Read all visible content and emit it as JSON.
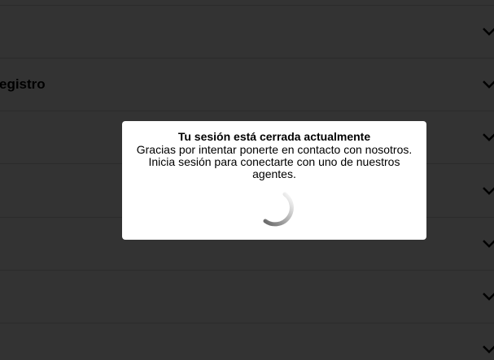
{
  "accordion": {
    "items": [
      {
        "label": ""
      },
      {
        "label": "egistro"
      },
      {
        "label": ""
      },
      {
        "label": ""
      },
      {
        "label": ""
      },
      {
        "label": ""
      },
      {
        "label": ""
      }
    ]
  },
  "modal": {
    "title": "Tu sesión está cerrada actualmente",
    "message_line1": "Gracias por intentar ponerte en contacto con nosotros.",
    "message_line2": "Inicia sesión para conectarte con uno de nuestros",
    "message_line3": "agentes.",
    "spinner_icon": "loading-spinner-icon"
  },
  "colors": {
    "overlay": "#333333",
    "modal_background": "#ffffff",
    "text": "#000000"
  }
}
